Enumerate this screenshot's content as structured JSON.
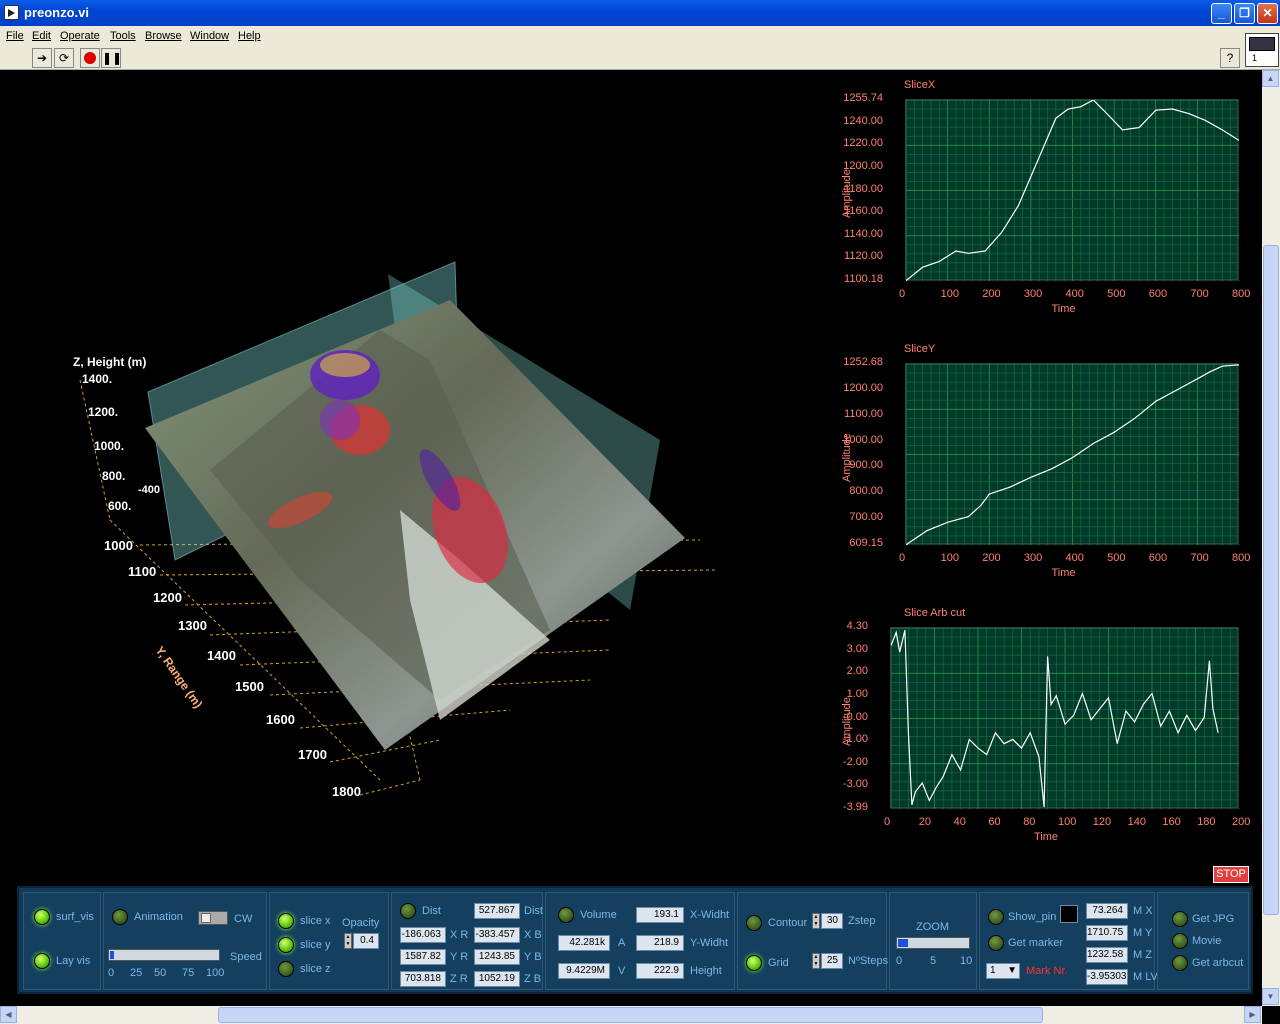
{
  "window": {
    "title": "preonzo.vi"
  },
  "menu": [
    "File",
    "Edit",
    "Operate",
    "Tools",
    "Browse",
    "Window",
    "Help"
  ],
  "vi_icon_text": "1",
  "view3d": {
    "z_axis_title": "Z, Height (m)",
    "z_ticks": [
      "1400.",
      "1200.",
      "1000.",
      "800.",
      "600."
    ],
    "y_axis_title": "Y, Range (m)",
    "y_ticks": [
      "1000",
      "1100",
      "1200",
      "1300",
      "1400",
      "1500",
      "1600",
      "1700",
      "1800"
    ],
    "x_tick": "-400"
  },
  "charts": [
    {
      "title": "SliceX",
      "ylabel": "Amplitude",
      "xlabel": "Time"
    },
    {
      "title": "SliceY",
      "ylabel": "Amplitude",
      "xlabel": "Time"
    },
    {
      "title": "Slice Arb cut",
      "ylabel": "Amplitude",
      "xlabel": "Time"
    }
  ],
  "chart_data": [
    {
      "type": "line",
      "title": "SliceX",
      "xlabel": "Time",
      "ylabel": "Amplitude",
      "xlim": [
        0,
        800
      ],
      "ylim": [
        1100.18,
        1255.74
      ],
      "x_ticks": [
        "0",
        "100",
        "200",
        "300",
        "400",
        "500",
        "600",
        "700",
        "800"
      ],
      "y_ticks": [
        "1255.74",
        "1240.00",
        "1220.00",
        "1200.00",
        "1180.00",
        "1160.00",
        "1140.00",
        "1120.00",
        "1100.18"
      ],
      "x": [
        0,
        40,
        80,
        120,
        150,
        190,
        230,
        270,
        300,
        330,
        360,
        390,
        420,
        450,
        480,
        520,
        560,
        600,
        640,
        680,
        720,
        760,
        800
      ],
      "values": [
        1100.5,
        1112,
        1117,
        1126,
        1124,
        1126,
        1142,
        1165,
        1190,
        1215,
        1240,
        1248,
        1250,
        1256,
        1245,
        1230,
        1232,
        1247,
        1248,
        1244,
        1238,
        1230,
        1221
      ]
    },
    {
      "type": "line",
      "title": "SliceY",
      "xlabel": "Time",
      "ylabel": "Amplitude",
      "xlim": [
        0,
        800
      ],
      "ylim": [
        609.15,
        1252.68
      ],
      "x_ticks": [
        "0",
        "100",
        "200",
        "300",
        "400",
        "500",
        "600",
        "700",
        "800"
      ],
      "y_ticks": [
        "1252.68",
        "1200.00",
        "1100.00",
        "1000.00",
        "900.00",
        "800.00",
        "700.00",
        "609.15"
      ],
      "x": [
        0,
        50,
        100,
        150,
        180,
        200,
        250,
        300,
        350,
        400,
        450,
        500,
        550,
        600,
        650,
        700,
        730,
        760,
        800
      ],
      "values": [
        610,
        660,
        690,
        710,
        750,
        790,
        815,
        850,
        880,
        920,
        970,
        1010,
        1060,
        1120,
        1160,
        1200,
        1225,
        1245,
        1250
      ]
    },
    {
      "type": "line",
      "title": "Slice Arb cut",
      "xlabel": "Time",
      "ylabel": "Amplitude",
      "xlim": [
        0,
        200
      ],
      "ylim": [
        -3.99,
        4.3
      ],
      "x_ticks": [
        "0",
        "20",
        "40",
        "60",
        "80",
        "100",
        "120",
        "140",
        "160",
        "180",
        "200"
      ],
      "y_ticks": [
        "4.30",
        "3.00",
        "2.00",
        "1.00",
        "0.00",
        "-1.00",
        "-2.00",
        "-3.00",
        "-3.99"
      ],
      "x": [
        0,
        3,
        5,
        8,
        10,
        12,
        14,
        18,
        22,
        26,
        30,
        35,
        40,
        45,
        50,
        55,
        60,
        65,
        70,
        75,
        80,
        85,
        88,
        90,
        92,
        95,
        100,
        105,
        110,
        115,
        120,
        125,
        130,
        135,
        140,
        145,
        150,
        155,
        160,
        165,
        170,
        175,
        180,
        183,
        185,
        188
      ],
      "values": [
        3.5,
        4.1,
        3.2,
        4.2,
        -0.5,
        -3.8,
        -3.2,
        -2.8,
        -3.6,
        -3.0,
        -2.5,
        -1.5,
        -2.2,
        -0.8,
        -1.2,
        -1.5,
        -0.5,
        -1.0,
        -0.8,
        -1.2,
        -0.5,
        -1.6,
        -3.9,
        3.0,
        0.8,
        1.2,
        -0.1,
        0.3,
        1.3,
        0.1,
        0.6,
        1.1,
        -1.0,
        0.5,
        0.0,
        0.8,
        1.3,
        -0.2,
        0.5,
        -0.5,
        0.3,
        -0.4,
        0.2,
        2.8,
        0.6,
        -0.5
      ]
    }
  ],
  "stop_label": "STOP",
  "panel": {
    "surf_vis": "surf_vis",
    "lay_vis": "Lay vis",
    "animation": "Animation",
    "cw": "CW",
    "speed": "Speed",
    "slider_ticks": [
      "0",
      "25",
      "50",
      "75",
      "100"
    ],
    "slice_x": "slice x",
    "slice_y": "slice y",
    "slice_z": "slice z",
    "opacity": "Opacity",
    "opacity_value": "0.4",
    "dist": "Dist",
    "dist_value": "527.867",
    "dist_label2": "Dist",
    "xr": "-186.063",
    "xr_label": "X R",
    "xb": "-383.457",
    "xb_label": "X B",
    "yr": "1587.82",
    "yr_label": "Y R",
    "yb": "1243.85",
    "yb_label": "Y B",
    "zr": "703.818",
    "zr_label": "Z R",
    "zb": "1052.19",
    "zb_label": "Z B",
    "volume": "Volume",
    "a_value": "42.281k",
    "a_label": "A",
    "v_value": "9.4229M",
    "v_label": "V",
    "xw_value": "193.1",
    "xw_label": "X-Widht",
    "yw_value": "218.9",
    "yw_label": "Y-Widht",
    "h_value": "222.9",
    "h_label": "Height",
    "contour": "Contour",
    "zstep_value": "30",
    "zstep": "Zstep",
    "grid": "Grid",
    "nsteps_value": "25",
    "nsteps": "NºSteps",
    "zoom": "ZOOM",
    "zoom_ticks": [
      "0",
      "5",
      "10"
    ],
    "show_pin": "Show_pin",
    "get_marker": "Get marker",
    "mark_nr_value": "1",
    "mark_nr": "Mark Nr.",
    "mx": "73.264",
    "mx_label": "M X",
    "my": "1710.75",
    "my_label": "M Y",
    "mz": "1232.58",
    "mz_label": "M Z",
    "mlv": "-3.95303",
    "mlv_label": "M LV",
    "get_jpg": "Get JPG",
    "movie": "Movie",
    "get_arbcut": "Get arbcut"
  }
}
